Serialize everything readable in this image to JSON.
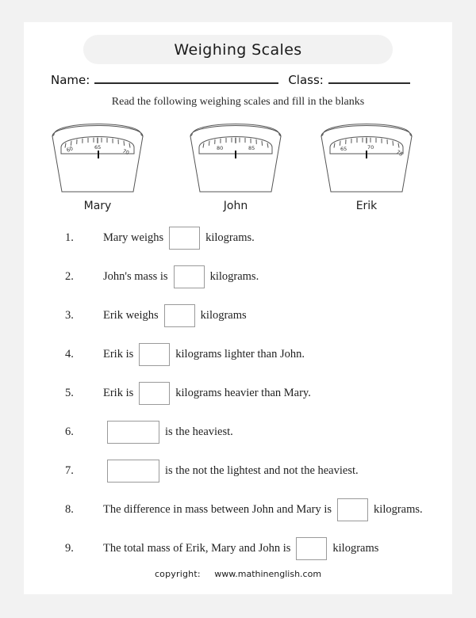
{
  "worksheet": {
    "title": "Weighing Scales",
    "name_label": "Name:",
    "class_label": "Class:",
    "instruction": "Read the following weighing scales and fill in the blanks"
  },
  "scales": [
    {
      "person": "Mary",
      "tick_labels": [
        "60",
        "65",
        "70"
      ],
      "needle_value": 66,
      "range_min": 58,
      "range_max": 72
    },
    {
      "person": "John",
      "tick_labels": [
        "80",
        "85"
      ],
      "needle_value": 83,
      "range_min": 78,
      "range_max": 88
    },
    {
      "person": "Erik",
      "tick_labels": [
        "65",
        "70",
        "75"
      ],
      "needle_value": 70,
      "range_min": 63,
      "range_max": 77
    }
  ],
  "questions": [
    {
      "number": "1.",
      "layout": "text-first",
      "before": "Mary weighs",
      "after": "kilograms.",
      "box": "small"
    },
    {
      "number": "2.",
      "layout": "text-first",
      "before": "John's mass is",
      "after": "kilograms.",
      "box": "small"
    },
    {
      "number": "3.",
      "layout": "text-first",
      "before": "Erik weighs",
      "after": "kilograms",
      "box": "small"
    },
    {
      "number": "4.",
      "layout": "text-first",
      "before": "Erik is",
      "after": "kilograms lighter than John.",
      "box": "small"
    },
    {
      "number": "5.",
      "layout": "text-first",
      "before": "Erik is",
      "after": "kilograms heavier than Mary.",
      "box": "small"
    },
    {
      "number": "6.",
      "layout": "box-first",
      "before": "",
      "after": "is the heaviest.",
      "box": "wide"
    },
    {
      "number": "7.",
      "layout": "box-first",
      "before": "",
      "after": "is the not the lightest and not the heaviest.",
      "box": "wide"
    },
    {
      "number": "8.",
      "layout": "text-first",
      "before": "The difference in mass between John and Mary is",
      "after": "kilograms.",
      "box": "small"
    },
    {
      "number": "9.",
      "layout": "text-first",
      "before": "The total mass of Erik, Mary and John is",
      "after": "kilograms",
      "box": "small"
    }
  ],
  "footer": {
    "copyright_label": "copyright:",
    "url": "www.mathinenglish.com"
  },
  "colors": {
    "page_background": "#ffffff",
    "outer_background": "#f2f2f2",
    "banner_background": "#f2f2f2",
    "text": "#222222",
    "box_border": "#9a9a9a",
    "scale_outline": "#555555",
    "needle": "#111111"
  }
}
